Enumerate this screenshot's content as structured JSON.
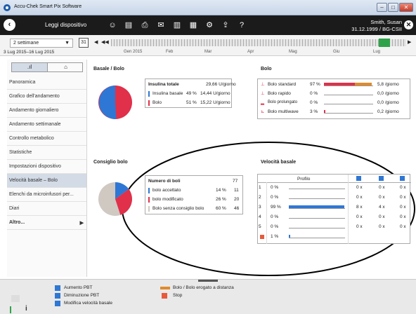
{
  "app": {
    "title": "Accu-Chek Smart Pix Software"
  },
  "toolbar": {
    "read_device": "Leggi dispositivo",
    "user_name": "Smith, Susan",
    "user_info": "31.12.1999 / BG-CSII"
  },
  "timeline": {
    "period": "2 settimane",
    "cal_day": "31",
    "range": "3 Lug 2015–16 Lug 2015",
    "months": [
      "Gen 2015",
      "Feb",
      "Mar",
      "Apr",
      "Mag",
      "Giu",
      "Lug"
    ]
  },
  "sidebar": {
    "items": [
      "Panoramica",
      "Grafico dell'andamento",
      "Andamento giornaliero",
      "Andamento settimanale",
      "Controllo metabolico",
      "Statistiche",
      "Impostazioni dispositivo",
      "Velocità basale – Bolo",
      "Elenchi da microinfusori per...",
      "Diari",
      "Altro..."
    ]
  },
  "basal_bolus": {
    "heading": "Basale / Bolo",
    "total_label": "Insulina totale",
    "total_value": "29,66 U/giorno",
    "basal_label": "Insulina basale",
    "basal_pct": "49 %",
    "basal_value": "14,44 U/giorno",
    "bolus_label": "Bolo",
    "bolus_pct": "51 %",
    "bolus_value": "15,22 U/giorno"
  },
  "bolus": {
    "heading": "Bolo",
    "rows": [
      {
        "label": "Bolo standard",
        "pct": "97 %",
        "value": "5,8 /giorno",
        "fill": 0.97
      },
      {
        "label": "Bolo rapido",
        "pct": "0 %",
        "value": "0,0 /giorno",
        "fill": 0
      },
      {
        "label": "Bolo prolungato",
        "pct": "0 %",
        "value": "0,0 /giorno",
        "fill": 0
      },
      {
        "label": "Bolo multiwave",
        "pct": "3 %",
        "value": "0,2 /giorno",
        "fill": 0.03
      }
    ]
  },
  "advice": {
    "heading": "Consiglio bolo",
    "count_label": "Numero di boli",
    "count_value": "77",
    "rows": [
      {
        "label": "bolo accettato",
        "pct": "14 %",
        "value": "11"
      },
      {
        "label": "bolo modificato",
        "pct": "26 %",
        "value": "20"
      },
      {
        "label": "Bolo senza consiglio bolo",
        "pct": "60 %",
        "value": "46"
      }
    ]
  },
  "basal_rate": {
    "heading": "Velocità basale",
    "profile_label": "Profilo",
    "rows": [
      {
        "n": "1",
        "pct": "0 %",
        "a": "0 x",
        "b": "0 x",
        "c": "0 x",
        "fill": 0
      },
      {
        "n": "2",
        "pct": "0 %",
        "a": "0 x",
        "b": "0 x",
        "c": "0 x",
        "fill": 0
      },
      {
        "n": "3",
        "pct": "99 %",
        "a": "8 x",
        "b": "4 x",
        "c": "0 x",
        "fill": 0.99
      },
      {
        "n": "4",
        "pct": "0 %",
        "a": "0 x",
        "b": "0 x",
        "c": "0 x",
        "fill": 0
      },
      {
        "n": "5",
        "pct": "0 %",
        "a": "0 x",
        "b": "0 x",
        "c": "0 x",
        "fill": 0
      },
      {
        "n": "",
        "pct": "1 %",
        "a": "",
        "b": "",
        "c": "",
        "fill": 0.01
      }
    ]
  },
  "legend": {
    "items": [
      "Aumento PBT",
      "Diminuzione PBT",
      "Modifica velocità basale"
    ],
    "remote": "Bolo / Bolo erogato a distanza",
    "stop": "Stop"
  },
  "colors": {
    "basal": "#2f77d4",
    "bolus": "#e0304a",
    "accepted": "#2f77d4",
    "modified": "#e0304a",
    "none": "#cfc9c2",
    "green": "#2fa34a",
    "accent_orange": "#e08a2a"
  }
}
